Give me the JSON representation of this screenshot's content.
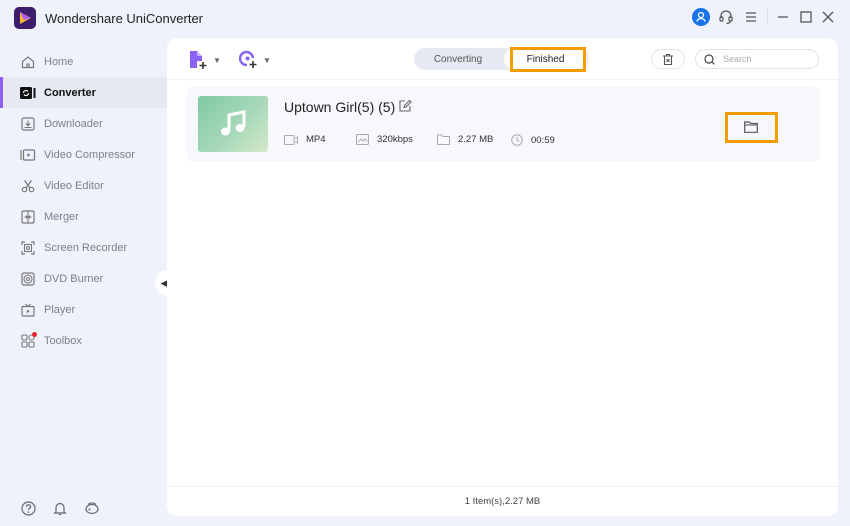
{
  "window": {
    "title": "Wondershare UniConverter",
    "controls": [
      "account-icon",
      "support-icon",
      "menu-icon",
      "minimize-icon",
      "maximize-icon",
      "close-icon"
    ],
    "accent": "#8a63f5",
    "account_color": "#1a73e8"
  },
  "sidebar": {
    "items": [
      {
        "label": "Home",
        "icon": "home-icon",
        "active": false
      },
      {
        "label": "Converter",
        "icon": "converter-icon",
        "active": true
      },
      {
        "label": "Downloader",
        "icon": "downloader-icon",
        "active": false
      },
      {
        "label": "Video Compressor",
        "icon": "video-compressor-icon",
        "active": false
      },
      {
        "label": "Video Editor",
        "icon": "video-editor-icon",
        "active": false
      },
      {
        "label": "Merger",
        "icon": "merger-icon",
        "active": false
      },
      {
        "label": "Screen Recorder",
        "icon": "screen-recorder-icon",
        "active": false
      },
      {
        "label": "DVD Burner",
        "icon": "dvd-burner-icon",
        "active": false
      },
      {
        "label": "Player",
        "icon": "player-icon",
        "active": false
      },
      {
        "label": "Toolbox",
        "icon": "toolbox-icon",
        "active": false,
        "badge": true
      }
    ],
    "collapse_icon": "chevron-left-icon",
    "bottom_icons": [
      "help-icon",
      "bell-icon",
      "feedback-icon"
    ]
  },
  "toolbar": {
    "add_file_icon": "add-file-icon",
    "add_media_icon": "add-media-icon",
    "tabs": [
      {
        "label": "Converting",
        "active": false
      },
      {
        "label": "Finished",
        "active": true
      }
    ],
    "search": {
      "placeholder": "Search",
      "value": ""
    },
    "highlight_color": "#f59c00"
  },
  "files": [
    {
      "name": "Uptown Girl(5) (5)",
      "format": "MP4",
      "bitrate": "320kbps",
      "size": "2.27 MB",
      "duration": "00:59",
      "thumbnail_icon": "music-note-icon"
    }
  ],
  "status": {
    "summary": "1 Item(s),2.27 MB"
  }
}
